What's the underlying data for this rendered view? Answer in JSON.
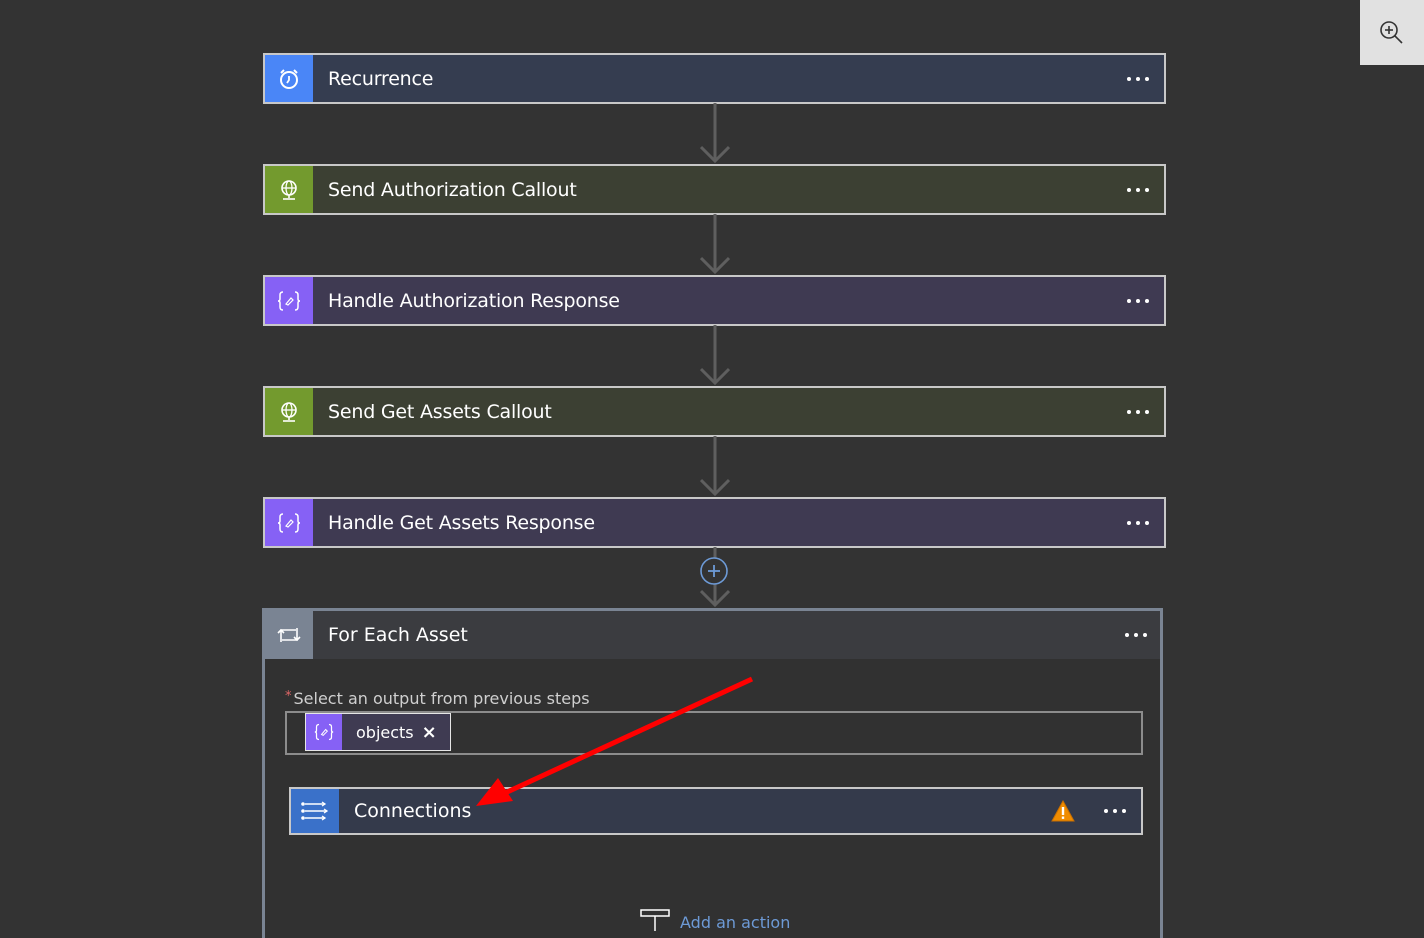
{
  "toolbar": {
    "zoom_icon": "zoom-in-icon"
  },
  "steps": [
    {
      "title": "Recurrence",
      "icon": "alarm-clock-icon",
      "accent": "#4a86f7",
      "background": "#353d50"
    },
    {
      "title": "Send Authorization Callout",
      "icon": "globe-icon",
      "accent": "#739a2e",
      "background": "#3c4033"
    },
    {
      "title": "Handle Authorization Response",
      "icon": "code-braces-icon",
      "accent": "#8661f5",
      "background": "#3f3a52"
    },
    {
      "title": "Send Get Assets Callout",
      "icon": "globe-icon",
      "accent": "#739a2e",
      "background": "#3c4033"
    },
    {
      "title": "Handle Get Assets Response",
      "icon": "code-braces-icon",
      "accent": "#8661f5",
      "background": "#3f3a52"
    }
  ],
  "foreach": {
    "title": "For Each Asset",
    "icon": "loop-icon",
    "field_label": "Select an output from previous steps",
    "required_marker": "*",
    "token": {
      "label": "objects",
      "close": "×",
      "icon": "code-braces-icon"
    },
    "inner_action": {
      "title": "Connections",
      "icon": "compose-arrows-icon",
      "status": "warning"
    },
    "add_action_label": "Add an action"
  },
  "annotation": {
    "type": "red-arrow",
    "color": "#ff0000",
    "points_to": "Connections"
  }
}
